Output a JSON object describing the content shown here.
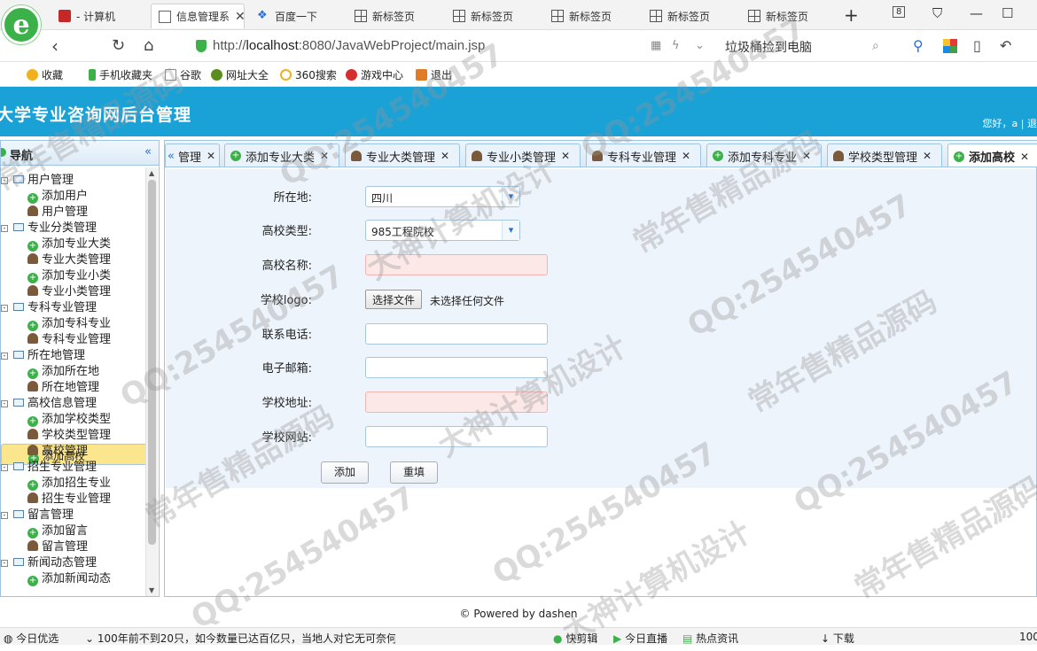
{
  "browser": {
    "tabs": [
      {
        "label": "- 计算机",
        "icon": "red-flag-icon"
      },
      {
        "label": "信息管理系",
        "icon": "page-icon",
        "active": true
      },
      {
        "label": "百度一下",
        "icon": "baidu-paw-icon"
      },
      {
        "label": "新标签页",
        "icon": "grid-icon"
      },
      {
        "label": "新标签页",
        "icon": "grid-icon"
      },
      {
        "label": "新标签页",
        "icon": "grid-icon"
      },
      {
        "label": "新标签页",
        "icon": "grid-icon"
      },
      {
        "label": "新标签页",
        "icon": "grid-icon"
      }
    ],
    "tab_count": "8",
    "url_prefix": "http://",
    "url_host": "localhost",
    "url_rest": ":8080/JavaWebProject/main.jsp",
    "search_text": "垃圾桶捡到电脑",
    "bookmarks": [
      "收藏",
      "手机收藏夹",
      "谷歌",
      "网址大全",
      "360搜索",
      "游戏中心",
      "退出"
    ]
  },
  "app": {
    "title": "大学专业咨询网后台管理",
    "greeting": "您好，a | 退"
  },
  "sidebar": {
    "title": "导航",
    "collapse_icon": "double-chevron-left-icon",
    "tree": [
      {
        "label": "用户管理",
        "children": [
          "添加用户",
          "用户管理"
        ]
      },
      {
        "label": "专业分类管理",
        "children": [
          "添加专业大类",
          "专业大类管理",
          "添加专业小类",
          "专业小类管理"
        ]
      },
      {
        "label": "专科专业管理",
        "children": [
          "添加专科专业",
          "专科专业管理"
        ]
      },
      {
        "label": "所在地管理",
        "children": [
          "添加所在地",
          "所在地管理"
        ]
      },
      {
        "label": "高校信息管理",
        "children": [
          "添加学校类型",
          "学校类型管理",
          "添加高校",
          "高校管理"
        ]
      },
      {
        "label": "招生专业管理",
        "children": [
          "添加招生专业",
          "招生专业管理"
        ]
      },
      {
        "label": "留言管理",
        "children": [
          "添加留言",
          "留言管理"
        ]
      },
      {
        "label": "新闻动态管理",
        "children": [
          "添加新闻动态"
        ]
      }
    ],
    "selected": "添加高校"
  },
  "page_tabs": [
    {
      "label": "管理",
      "icon": "none"
    },
    {
      "label": "添加专业大类",
      "icon": "add"
    },
    {
      "label": "专业大类管理",
      "icon": "user"
    },
    {
      "label": "专业小类管理",
      "icon": "user"
    },
    {
      "label": "专科专业管理",
      "icon": "user"
    },
    {
      "label": "添加专科专业",
      "icon": "add"
    },
    {
      "label": "学校类型管理",
      "icon": "user"
    },
    {
      "label": "添加高校",
      "icon": "add",
      "active": true
    }
  ],
  "form": {
    "location_label": "所在地:",
    "location_value": "四川",
    "type_label": "高校类型:",
    "type_value": "985工程院校",
    "name_label": "高校名称:",
    "logo_label": "学校logo:",
    "file_button": "选择文件",
    "file_status": "未选择任何文件",
    "phone_label": "联系电话:",
    "email_label": "电子邮箱:",
    "address_label": "学校地址:",
    "website_label": "学校网站:",
    "submit": "添加",
    "reset": "重填"
  },
  "footer": "© Powered by dashen",
  "statusbar": {
    "left": "今日优选",
    "news": "100年前不到20只，如今数量已达百亿只，当地人对它无可奈何",
    "items": [
      "快剪辑",
      "今日直播",
      "热点资讯",
      "下载",
      "100"
    ]
  },
  "watermarks": [
    "常年售精品源码",
    "QQ:254540457",
    "大神计算机设计"
  ]
}
